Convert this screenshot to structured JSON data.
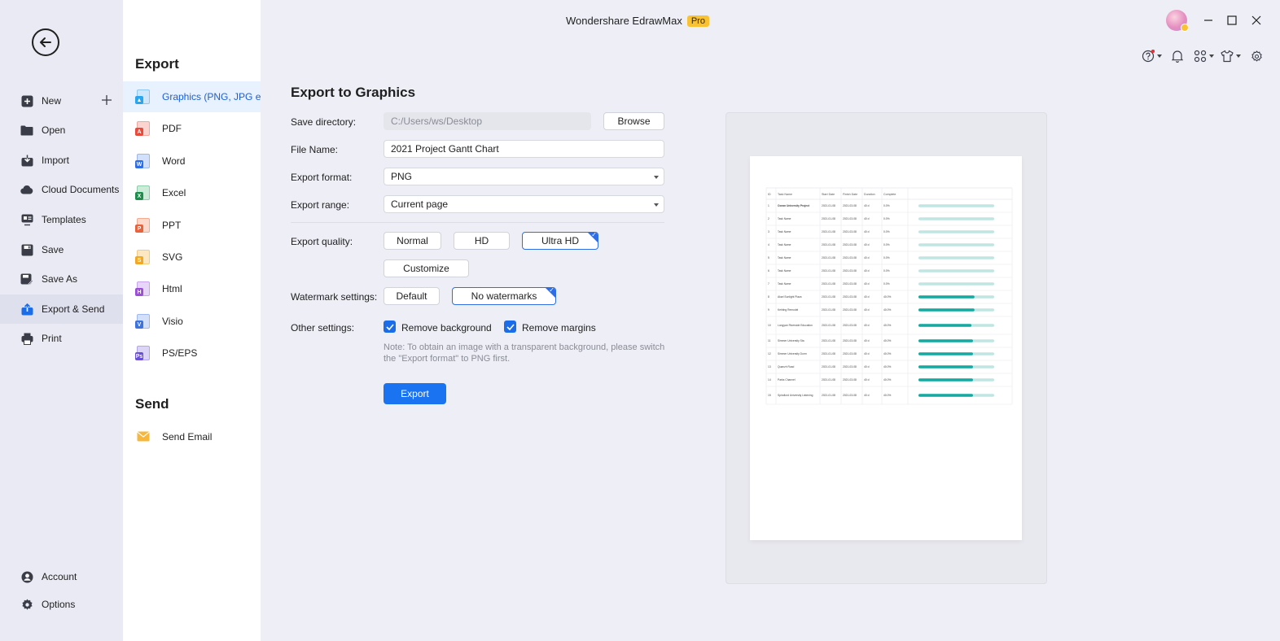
{
  "app": {
    "title": "Wondershare EdrawMax",
    "badge": "Pro"
  },
  "nav": {
    "items": [
      {
        "label": "New",
        "icon": "new-icon"
      },
      {
        "label": "Open",
        "icon": "folder-icon"
      },
      {
        "label": "Import",
        "icon": "import-icon"
      },
      {
        "label": "Cloud Documents",
        "icon": "cloud-icon"
      },
      {
        "label": "Templates",
        "icon": "templates-icon"
      },
      {
        "label": "Save",
        "icon": "save-icon"
      },
      {
        "label": "Save As",
        "icon": "save-as-icon"
      },
      {
        "label": "Export & Send",
        "icon": "export-icon"
      },
      {
        "label": "Print",
        "icon": "print-icon"
      }
    ],
    "bottom": [
      {
        "label": "Account",
        "icon": "account-icon"
      },
      {
        "label": "Options",
        "icon": "gear-icon"
      }
    ]
  },
  "export_menu": {
    "title": "Export",
    "items": [
      {
        "label": "Graphics (PNG, JPG e...",
        "color": "#4aa8f0"
      },
      {
        "label": "PDF",
        "color": "#e84a3c"
      },
      {
        "label": "Word",
        "color": "#2d6ee6"
      },
      {
        "label": "Excel",
        "color": "#1e8e4d"
      },
      {
        "label": "PPT",
        "color": "#e8623c"
      },
      {
        "label": "SVG",
        "color": "#f0a826"
      },
      {
        "label": "Html",
        "color": "#9b4fd8"
      },
      {
        "label": "Visio",
        "color": "#3d73e0"
      },
      {
        "label": "PS/EPS",
        "color": "#6a4fd8"
      }
    ],
    "send_title": "Send",
    "send_items": [
      {
        "label": "Send Email",
        "color": "#f6b73c"
      }
    ]
  },
  "form": {
    "title": "Export to Graphics",
    "save_directory_label": "Save directory:",
    "save_directory_value": "C:/Users/ws/Desktop",
    "browse_label": "Browse",
    "file_name_label": "File Name:",
    "file_name_value": "2021 Project Gantt Chart",
    "format_label": "Export format:",
    "format_value": "PNG",
    "range_label": "Export range:",
    "range_value": "Current page",
    "quality_label": "Export quality:",
    "quality_options": [
      "Normal",
      "HD",
      "Ultra HD"
    ],
    "quality_selected": "Ultra HD",
    "customize_label": "Customize",
    "watermark_label": "Watermark settings:",
    "watermark_options": [
      "Default",
      "No watermarks"
    ],
    "watermark_selected": "No watermarks",
    "other_label": "Other settings:",
    "remove_background_label": "Remove background",
    "remove_background_checked": true,
    "remove_margins_label": "Remove margins",
    "remove_margins_checked": true,
    "note": "Note: To obtain an image with a transparent background, please switch the \"Export format\" to PNG first.",
    "export_label": "Export"
  },
  "preview": {
    "headers": [
      "ID",
      "Task Name",
      "Start Date",
      "Finish Date",
      "Duration",
      "Complete"
    ],
    "rows": [
      {
        "id": "1",
        "name": "Ocean University Project",
        "start": "2021-01-08",
        "finish": "2021-03-08",
        "dur": "40 d",
        "pct": "0.0%",
        "progress": 0
      },
      {
        "id": "2",
        "name": "Task Name",
        "start": "2021-01-08",
        "finish": "2021-03-08",
        "dur": "40 d",
        "pct": "0.0%",
        "progress": 0
      },
      {
        "id": "3",
        "name": "Task Name",
        "start": "2021-01-08",
        "finish": "2021-03-08",
        "dur": "40 d",
        "pct": "0.0%",
        "progress": 0
      },
      {
        "id": "4",
        "name": "Task Name",
        "start": "2021-01-08",
        "finish": "2021-03-08",
        "dur": "40 d",
        "pct": "0.0%",
        "progress": 0
      },
      {
        "id": "5",
        "name": "Task Name",
        "start": "2021-01-08",
        "finish": "2021-03-08",
        "dur": "40 d",
        "pct": "0.0%",
        "progress": 0
      },
      {
        "id": "6",
        "name": "Task Name",
        "start": "2021-01-08",
        "finish": "2021-03-08",
        "dur": "40 d",
        "pct": "0.0%",
        "progress": 0
      },
      {
        "id": "7",
        "name": "Task Name",
        "start": "2021-01-08",
        "finish": "2021-03-08",
        "dur": "40 d",
        "pct": "0.0%",
        "progress": 0
      },
      {
        "id": "8",
        "name": "Akari Sunlight Plaza",
        "start": "2021-01-08",
        "finish": "2021-03-08",
        "dur": "40 d",
        "pct": "40.0%",
        "progress": 0.74
      },
      {
        "id": "9",
        "name": "Kehting Remodel",
        "start": "2021-01-08",
        "finish": "2021-03-08",
        "dur": "40 d",
        "pct": "40.0%",
        "progress": 0.74
      },
      {
        "id": "10",
        "name": "Longyan Riverside Education",
        "start": "2021-01-08",
        "finish": "2021-03-08",
        "dur": "40 d",
        "pct": "40.0%",
        "progress": 0.7,
        "tall": true
      },
      {
        "id": "11",
        "name": "Simmer University Sta",
        "start": "2021-01-08",
        "finish": "2021-03-08",
        "dur": "40 d",
        "pct": "40.0%",
        "progress": 0.72
      },
      {
        "id": "12",
        "name": "Simmer University Dorm",
        "start": "2021-01-08",
        "finish": "2021-03-08",
        "dur": "40 d",
        "pct": "40.0%",
        "progress": 0.72
      },
      {
        "id": "13",
        "name": "Quanzh Road",
        "start": "2021-01-08",
        "finish": "2021-03-08",
        "dur": "40 d",
        "pct": "40.0%",
        "progress": 0.72
      },
      {
        "id": "14",
        "name": "Parks Channel",
        "start": "2021-01-08",
        "finish": "2021-03-08",
        "dur": "40 d",
        "pct": "40.0%",
        "progress": 0.72
      },
      {
        "id": "15",
        "name": "Spindlord University Listening",
        "start": "2021-01-08",
        "finish": "2021-03-08",
        "dur": "40 d",
        "pct": "40.0%",
        "progress": 0.72,
        "tall": true
      }
    ],
    "bar_color": "#14a9a1",
    "bar_light": "#bfe6e3"
  }
}
